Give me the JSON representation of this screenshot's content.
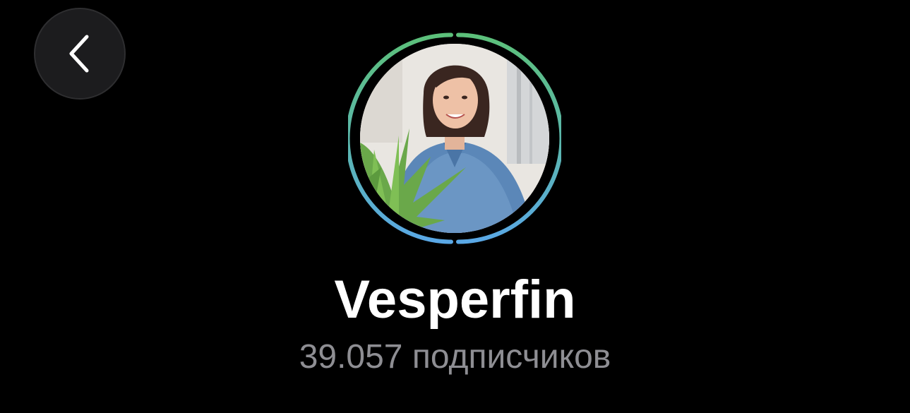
{
  "header": {
    "back_icon": "chevron-left-icon"
  },
  "profile": {
    "avatar_alt": "Vesperfin",
    "story_ring_colors": [
      "#5cc07a",
      "#5aa8e6"
    ],
    "name": "Vesperfin",
    "subscribers": "39.057 подписчиков"
  },
  "colors": {
    "background": "#000000",
    "name_text": "#ffffff",
    "subtitle_text": "#8e8e93",
    "back_button_bg": "#1c1c1e"
  }
}
